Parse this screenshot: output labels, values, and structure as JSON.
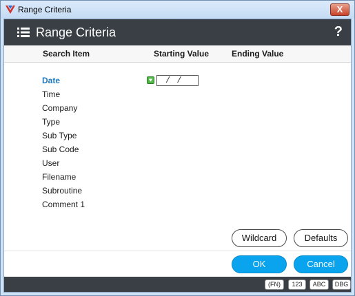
{
  "window": {
    "title": "Range Criteria",
    "close_label": "X"
  },
  "header": {
    "title": "Range Criteria",
    "help_label": "?"
  },
  "columns": {
    "search_item": "Search Item",
    "starting_value": "Starting Value",
    "ending_value": "Ending Value"
  },
  "items": [
    {
      "label": "Date"
    },
    {
      "label": "Time"
    },
    {
      "label": "Company"
    },
    {
      "label": "Type"
    },
    {
      "label": "Sub Type"
    },
    {
      "label": "Sub Code"
    },
    {
      "label": "User"
    },
    {
      "label": "Filename"
    },
    {
      "label": "Subroutine"
    },
    {
      "label": "Comment 1"
    }
  ],
  "date_field": {
    "value": "/  /"
  },
  "buttons": {
    "wildcard": "Wildcard",
    "defaults": "Defaults",
    "ok": "OK",
    "cancel": "Cancel"
  },
  "status_badges": [
    "(FN)",
    "123",
    "ABC",
    "DBG"
  ],
  "colors": {
    "header_bg": "#3a3f45",
    "accent": "#0aa3ee",
    "active_item": "#1c78c0",
    "dropdown_icon": "#51b848"
  }
}
